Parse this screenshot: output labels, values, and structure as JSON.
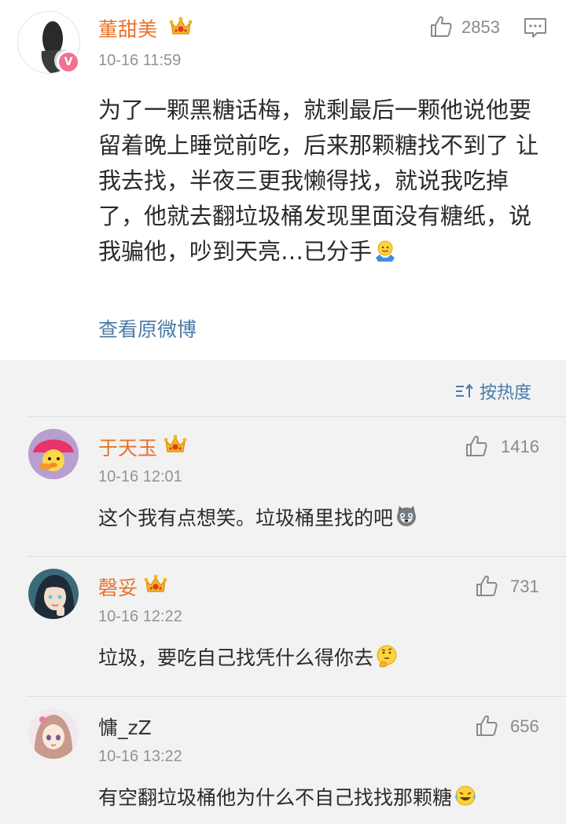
{
  "main_post": {
    "username": "董甜美",
    "timestamp": "10-16 11:59",
    "like_count": "2853",
    "text": "为了一颗黑糖话梅，就剩最后一颗他说他要留着晚上睡觉前吃，后来那颗糖找不到了 让我去找，半夜三更我懒得找，就说我吃掉了，他就去翻垃圾桶发现里面没有糖纸，说我骗他，吵到天亮…已分手",
    "emoji": "shrug-emoji",
    "view_original_label": "查看原微博"
  },
  "sort": {
    "label": "按热度",
    "icon": "sort-icon"
  },
  "comments": [
    {
      "username": "于天玉",
      "timestamp": "10-16 12:01",
      "like_count": "1416",
      "text": "这个我有点想笑。垃圾桶里找的吧",
      "emoji": "husky-emoji",
      "vip": true
    },
    {
      "username": "磬妥",
      "timestamp": "10-16 12:22",
      "like_count": "731",
      "text": "垃圾，要吃自己找凭什么得你去",
      "emoji": "thinking-emoji",
      "vip": true
    },
    {
      "username": "慵_zZ",
      "timestamp": "10-16 13:22",
      "like_count": "656",
      "text": "有空翻垃圾桶他为什么不自己找找那颗糖",
      "emoji": "laugh-cry-emoji",
      "vip": false
    }
  ],
  "colors": {
    "username": "#e8722a",
    "link": "#4a7ba8",
    "crown": "#f5a623",
    "verified_badge": "#f1718e"
  }
}
